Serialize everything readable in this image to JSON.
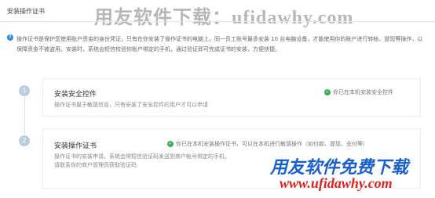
{
  "header": {
    "title": "安装操作证书"
  },
  "watermarks": {
    "top": "用友软件下载：ufidawhy.com",
    "bottom_brand": "用友软件免费下载",
    "bottom_url": "www.ufidawhy.com"
  },
  "notice": {
    "icon": "info-icon",
    "text": "操作证书是保护您使用账户资金的身份凭证，只有在你安装了操作证书的电脑上，同一员工账号最多安装 10 台电脑设备，才能使用你的账户进行转帐、提现等操作，以保障资金不被盗用。安装时，系统会短信校验你账户绑定的手机，通过验证即可完成证书的安装，方便快捷。"
  },
  "steps": [
    {
      "number": "1",
      "title": "安装安全控件",
      "description": "操作证书属于敏感信息，只有安装了安全控件的用户才可以申请",
      "status_text": "你已在本机安装安全控件",
      "status_icon": "check-circle-icon"
    },
    {
      "number": "2",
      "title": "安装操作证书",
      "description_line1": "操作证书的安装申请，系统会将短信验证码发送到商户帐号绑定的手机，",
      "description_line2": "请联系你的商户管理员获取验证码",
      "status_text": "你已在本机安装操作证书，可以在本机进行敏感操作（如付款、提现、支付等）",
      "status_icon": "check-circle-icon"
    }
  ],
  "colors": {
    "info": "#2d8cf0",
    "success": "#3eae5b",
    "step_circle": "#b9cee0"
  }
}
